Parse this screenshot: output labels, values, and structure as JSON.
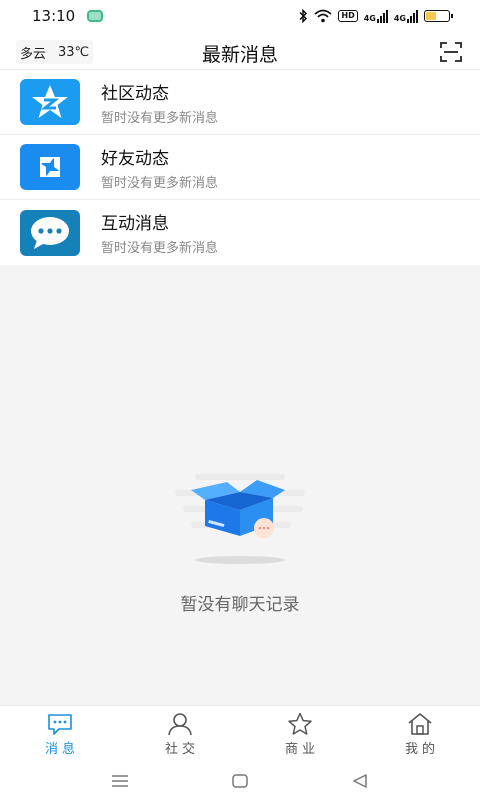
{
  "status_bar": {
    "time": "13:10",
    "hd_label": "HD",
    "net1": "4G",
    "net2": "4G",
    "battery_level": 0.45
  },
  "header": {
    "weather_condition": "多云",
    "temperature": "33℃",
    "title": "最新消息",
    "scan_icon": "scan-icon"
  },
  "messages": [
    {
      "title": "社区动态",
      "subtitle": "暂时没有更多新消息",
      "icon": "qzone-star-icon",
      "color": "#1b9cf0"
    },
    {
      "title": "好友动态",
      "subtitle": "暂时没有更多新消息",
      "icon": "friend-cycle-icon",
      "color": "#1a8cf0"
    },
    {
      "title": "互动消息",
      "subtitle": "暂时没有更多新消息",
      "icon": "chat-bubble-icon",
      "color": "#1581b8"
    }
  ],
  "empty_state": {
    "text": "暂没有聊天记录"
  },
  "tabs": [
    {
      "label": "消息",
      "icon": "message-icon",
      "active": true
    },
    {
      "label": "社交",
      "icon": "person-icon",
      "active": false
    },
    {
      "label": "商业",
      "icon": "star-icon",
      "active": false
    },
    {
      "label": "我的",
      "icon": "home-icon",
      "active": false
    }
  ],
  "colors": {
    "accent": "#1a8fd8",
    "background": "#f4f4f4"
  }
}
